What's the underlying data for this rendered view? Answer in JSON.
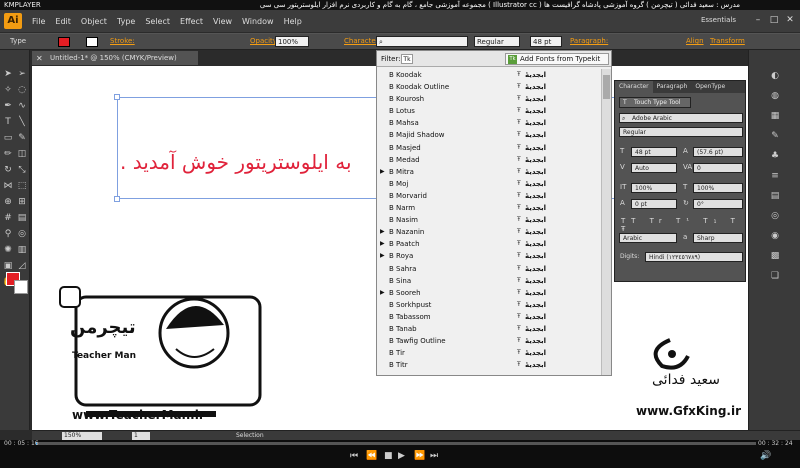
{
  "player": {
    "name": "KMPLAYER",
    "title": "مجموعه آموزشی جامع ، گام به گام و کاربردی نرم افزار ایلوستریتور سی سی ( Illustrator cc ) مدرس : سعید فدائی ( تیچرمن ) گروه آموزشی پادشاه گرافیست ها",
    "time_current": "00 : 05 : 16",
    "time_total": "00 : 32 : 24"
  },
  "menu": {
    "logo": "Ai",
    "items": [
      "File",
      "Edit",
      "Object",
      "Type",
      "Select",
      "Effect",
      "View",
      "Window",
      "Help"
    ],
    "workspace": "Essentials"
  },
  "control_bar": {
    "type_label": "Type",
    "stroke_label": "Stroke:",
    "opacity_label": "Opacity:",
    "opacity_value": "100%",
    "character_label": "Character:",
    "font_style": "Regular",
    "font_size": "48 pt",
    "paragraph_label": "Paragraph:",
    "align_label": "Align",
    "transform_label": "Transform"
  },
  "document": {
    "tab_title": "Untitled-1* @ 150% (CMYK/Preview)",
    "canvas_text": "به ایلوستریتور خوش آمدید ."
  },
  "font_panel": {
    "filter_label": "Filter:",
    "add_fonts_label": "Add Fonts from Typekit",
    "fonts": [
      {
        "name": "B Koodak",
        "sample": "ابجدیهٔ",
        "has_arrow": false
      },
      {
        "name": "B Koodak Outline",
        "sample": "ابجدیهٔ",
        "has_arrow": false
      },
      {
        "name": "B Kourosh",
        "sample": "ابجدیهٔ",
        "has_arrow": false
      },
      {
        "name": "B Lotus",
        "sample": "ابجدیهٔ",
        "has_arrow": false
      },
      {
        "name": "B Mahsa",
        "sample": "ابجدیهٔ",
        "has_arrow": false
      },
      {
        "name": "B Majid Shadow",
        "sample": "ابجدیهٔ",
        "has_arrow": false
      },
      {
        "name": "B Masjed",
        "sample": "ابجدیهٔ",
        "has_arrow": false
      },
      {
        "name": "B Medad",
        "sample": "ابجدیهٔ",
        "has_arrow": false
      },
      {
        "name": "B Mitra",
        "sample": "ابجدیهٔ",
        "has_arrow": true
      },
      {
        "name": "B Moj",
        "sample": "ابجدیهٔ",
        "has_arrow": false
      },
      {
        "name": "B Morvarid",
        "sample": "ابجدیهٔ",
        "has_arrow": false
      },
      {
        "name": "B Narm",
        "sample": "ابجدیهٔ",
        "has_arrow": false
      },
      {
        "name": "B Nasim",
        "sample": "ابجدیهٔ",
        "has_arrow": false
      },
      {
        "name": "B Nazanin",
        "sample": "ابجدیهٔ",
        "has_arrow": true
      },
      {
        "name": "B Paatch",
        "sample": "ابجدیهٔ",
        "has_arrow": true
      },
      {
        "name": "B Roya",
        "sample": "ابجدیهٔ",
        "has_arrow": true
      },
      {
        "name": "B Sahra",
        "sample": "ابجدیهٔ",
        "has_arrow": false
      },
      {
        "name": "B Sina",
        "sample": "ابجدیهٔ",
        "has_arrow": false
      },
      {
        "name": "B Sooreh",
        "sample": "ابجدیهٔ",
        "has_arrow": true
      },
      {
        "name": "B Sorkhpust",
        "sample": "ابجدیهٔ",
        "has_arrow": false
      },
      {
        "name": "B Tabassom",
        "sample": "ابجدیهٔ",
        "has_arrow": false
      },
      {
        "name": "B Tanab",
        "sample": "ابجدیهٔ",
        "has_arrow": false
      },
      {
        "name": "B Tawfig Outline",
        "sample": "ابجدیهٔ",
        "has_arrow": false
      },
      {
        "name": "B Tir",
        "sample": "ابجدیهٔ",
        "has_arrow": false
      },
      {
        "name": "B Titr",
        "sample": "ابجدیهٔ",
        "has_arrow": false
      }
    ]
  },
  "character_panel": {
    "tabs": [
      "Character",
      "Paragraph",
      "OpenType"
    ],
    "touch_type_label": "Touch Type Tool",
    "font_family": "Adobe Arabic",
    "font_style": "Regular",
    "size": "48 pt",
    "leading": "(57.6 pt)",
    "kerning": "Auto",
    "tracking": "0",
    "vscale": "100%",
    "hscale": "100%",
    "baseline": "0 pt",
    "rotation": "0°",
    "language": "Arabic",
    "antialias": "Sharp",
    "digits_label": "Digits:",
    "digits_value": "Hindi (١٢٣٤٥٦٧٨٩)"
  },
  "status_bar": {
    "zoom": "150%",
    "page": "1",
    "mode": "Selection"
  },
  "watermark": {
    "teacher_logo": "تیچرمن",
    "teacher_name": "Teacher Man",
    "teacher_url": "www.TeacherMan.ir",
    "gfx_name": "سعید فدائی",
    "gfx_url": "www.GfxKing.ir"
  },
  "colors": {
    "accent_orange": "#f39c12",
    "canvas_text": "#e0223a",
    "fill_swatch": "#e31e24"
  }
}
